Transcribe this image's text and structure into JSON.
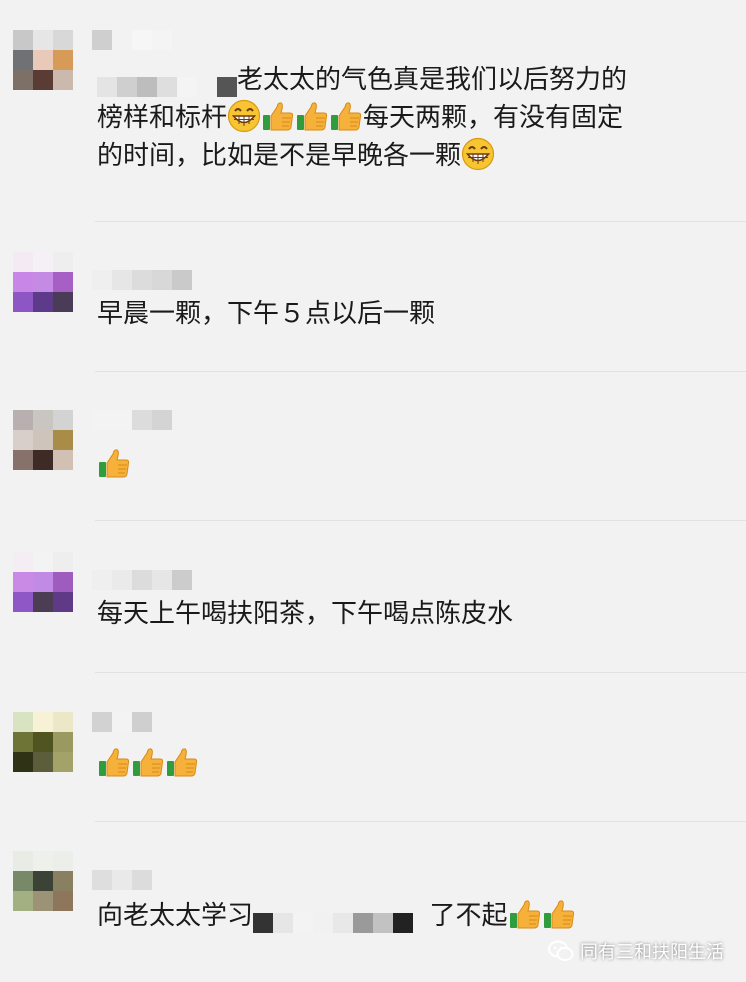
{
  "comments": [
    {
      "avatar_colors": [
        "#c8c8c8",
        "#e6e6e6",
        "#d8d8d8",
        "#6f7275",
        "#e9c9b7",
        "#d69c57",
        "#7d7067",
        "#5b3c34",
        "#cbb9ad"
      ],
      "text_line1_after_mosaic": "老太太的气色真是我们以后努力的",
      "text_line2_a": "榜样和标杆",
      "text_line2_b": "每天两颗，有没有固定",
      "text_line3": "的时间，比如是不是早晚各一颗"
    },
    {
      "avatar_colors": [
        "#f3eaf3",
        "#f5f0f5",
        "#eee",
        "#c887e6",
        "#c48ae4",
        "#a55fc5",
        "#8e55c4",
        "#5e3a8a",
        "#4a3c57"
      ],
      "text": "早晨一颗，下午５点以后一颗"
    },
    {
      "avatar_colors": [
        "#b8b0b0",
        "#c9c6c2",
        "#d3d3d3",
        "#d8cfcb",
        "#cfc4bc",
        "#a88c47",
        "#86726a",
        "#3e2b26",
        "#d1c0b3"
      ],
      "text": ""
    },
    {
      "avatar_colors": [
        "#f4eef4",
        "#f3f3f3",
        "#eee",
        "#c88ae4",
        "#c18ae4",
        "#9f5cbf",
        "#8f56c6",
        "#4a3d54",
        "#5e3a87"
      ],
      "text": "每天上午喝扶阳茶，下午喝点陈皮水"
    },
    {
      "avatar_colors": [
        "#d8e3c1",
        "#f7f2d6",
        "#ece7c6",
        "#6d7436",
        "#4f5420",
        "#9a9a60",
        "#2f3214",
        "#5c5e3b",
        "#a2a269"
      ],
      "text": ""
    },
    {
      "avatar_colors": [
        "#e8ece4",
        "#eef0ec",
        "#eceeea",
        "#788967",
        "#3d4236",
        "#888060",
        "#a3b081",
        "#9c9376",
        "#8e765c"
      ],
      "text_before_mosaic": "向老太太学习",
      "text_after_mosaic": "了不起"
    }
  ],
  "watermark": {
    "text": "同有三和扶阳生活",
    "icon": "wechat-channel-icon"
  },
  "emoji_names": {
    "grin": "grinning-face-icon",
    "thumbs": "thumbs-up-icon"
  }
}
